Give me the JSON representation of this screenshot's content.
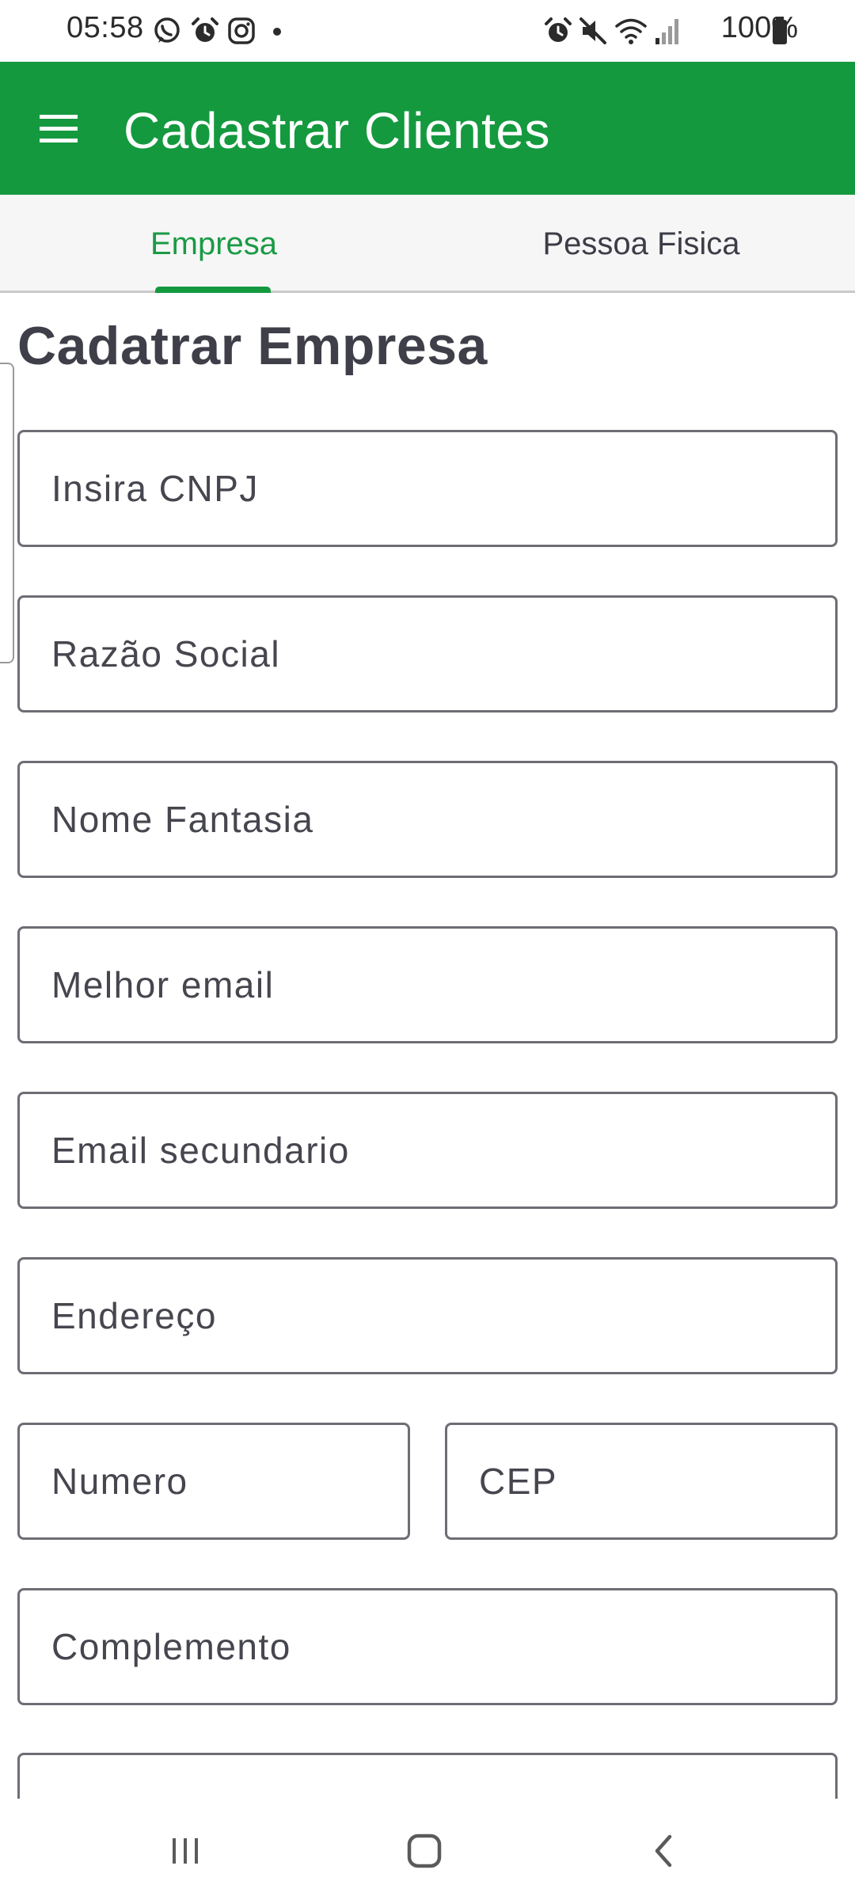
{
  "status_bar": {
    "time": "05:58",
    "battery": "100%",
    "left_icons": [
      "whatsapp-icon",
      "alarm-icon",
      "instagram-icon",
      "dot-icon"
    ],
    "right_icons": [
      "alarm-icon",
      "mute-icon",
      "wifi-icon",
      "signal-icon",
      "battery-icon"
    ]
  },
  "app_bar": {
    "title": "Cadastrar Clientes",
    "background": "#15993f"
  },
  "tabs": [
    {
      "label": "Empresa",
      "active": true
    },
    {
      "label": "Pessoa Fisica",
      "active": false
    }
  ],
  "form": {
    "heading": "Cadatrar Empresa",
    "fields": {
      "cnpj": {
        "placeholder": "Insira CNPJ",
        "value": ""
      },
      "razao_social": {
        "placeholder": "Razão Social",
        "value": ""
      },
      "nome_fantasia": {
        "placeholder": "Nome Fantasia",
        "value": ""
      },
      "melhor_email": {
        "placeholder": "Melhor email",
        "value": ""
      },
      "email_secundario": {
        "placeholder": "Email secundario",
        "value": ""
      },
      "endereco": {
        "placeholder": "Endereço",
        "value": ""
      },
      "numero": {
        "placeholder": "Numero",
        "value": ""
      },
      "cep": {
        "placeholder": "CEP",
        "value": ""
      },
      "complemento": {
        "placeholder": "Complemento",
        "value": ""
      }
    }
  },
  "nav_bar": {
    "icons": [
      "recent-apps-icon",
      "home-icon",
      "back-icon"
    ]
  },
  "colors": {
    "accent": "#15993f",
    "active_tab_text": "#1a9a45"
  }
}
